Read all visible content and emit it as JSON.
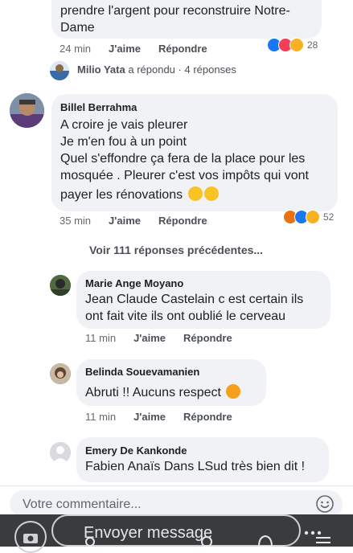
{
  "thread": {
    "top_partial": {
      "text_line1": "prendre l'argent pour reconstruire Notre-",
      "text_line2": "Dame",
      "time": "24 min",
      "like": "J'aime",
      "reply": "Répondre",
      "reaction_count": "28"
    },
    "reply_summary": {
      "name": "Milio Yata",
      "action": "a répondu",
      "sep": "·",
      "count": "4 réponses"
    },
    "main_comment": {
      "name": "Billel Berrahma",
      "line1": "A croire je vais pleurer",
      "line2": "Je m'en fou à un point",
      "line3": "Quel s'effondre ça fera de la place pour les",
      "line4": "mosquée . Pleurer c'est vos impôts qui vont",
      "line5": "payer les rénovations",
      "time": "35 min",
      "like": "J'aime",
      "reply": "Répondre",
      "reaction_count": "52"
    },
    "previous_replies": "Voir 111 réponses précédentes...",
    "replies": [
      {
        "name": "Marie Ange Moyano",
        "line1": "Jean Claude Castelain c est certain ils",
        "line2": "ont fait vite ils ont oublié le cerveau",
        "time": "11 min",
        "like": "J'aime",
        "reply": "Répondre"
      },
      {
        "name": "Belinda Souevamanien",
        "line1": "Abruti !! Aucuns respect",
        "time": "11 min",
        "like": "J'aime",
        "reply": "Répondre"
      },
      {
        "name": "Emery De Kankonde",
        "line1": "Fabien Anaïs Dans LSud très bien dit !"
      }
    ]
  },
  "composer": {
    "placeholder": "Votre commentaire..."
  },
  "story_bar": {
    "send_label": "Envoyer message"
  },
  "colors": {
    "bubble": "#f0f2f5",
    "meta": "#65676b",
    "like_blue": "#1877f2"
  }
}
